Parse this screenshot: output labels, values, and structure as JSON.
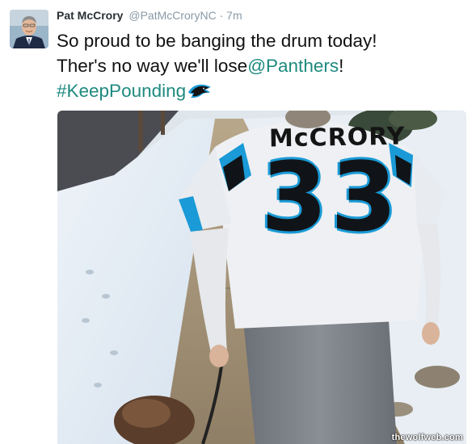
{
  "tweet": {
    "author_name": "Pat McCrory",
    "author_handle": "@PatMcCroryNC",
    "separator": "·",
    "time": "7m",
    "line1": "So proud to be banging the drum today!",
    "line2_prefix": "Ther's no way we'll lose",
    "mention": "@Panthers",
    "line2_suffix": "!",
    "hashtag": "#KeepPounding",
    "hashtag_emoji": "panthers-logo-icon"
  },
  "photo": {
    "jersey_name": "McCRORY",
    "jersey_number": "33",
    "watermark": "thewolfweb.com"
  },
  "colors": {
    "link": "#1e8a7f",
    "handle": "#8899a6",
    "name": "#292f33",
    "panthers_blue": "#1a9ad6"
  }
}
